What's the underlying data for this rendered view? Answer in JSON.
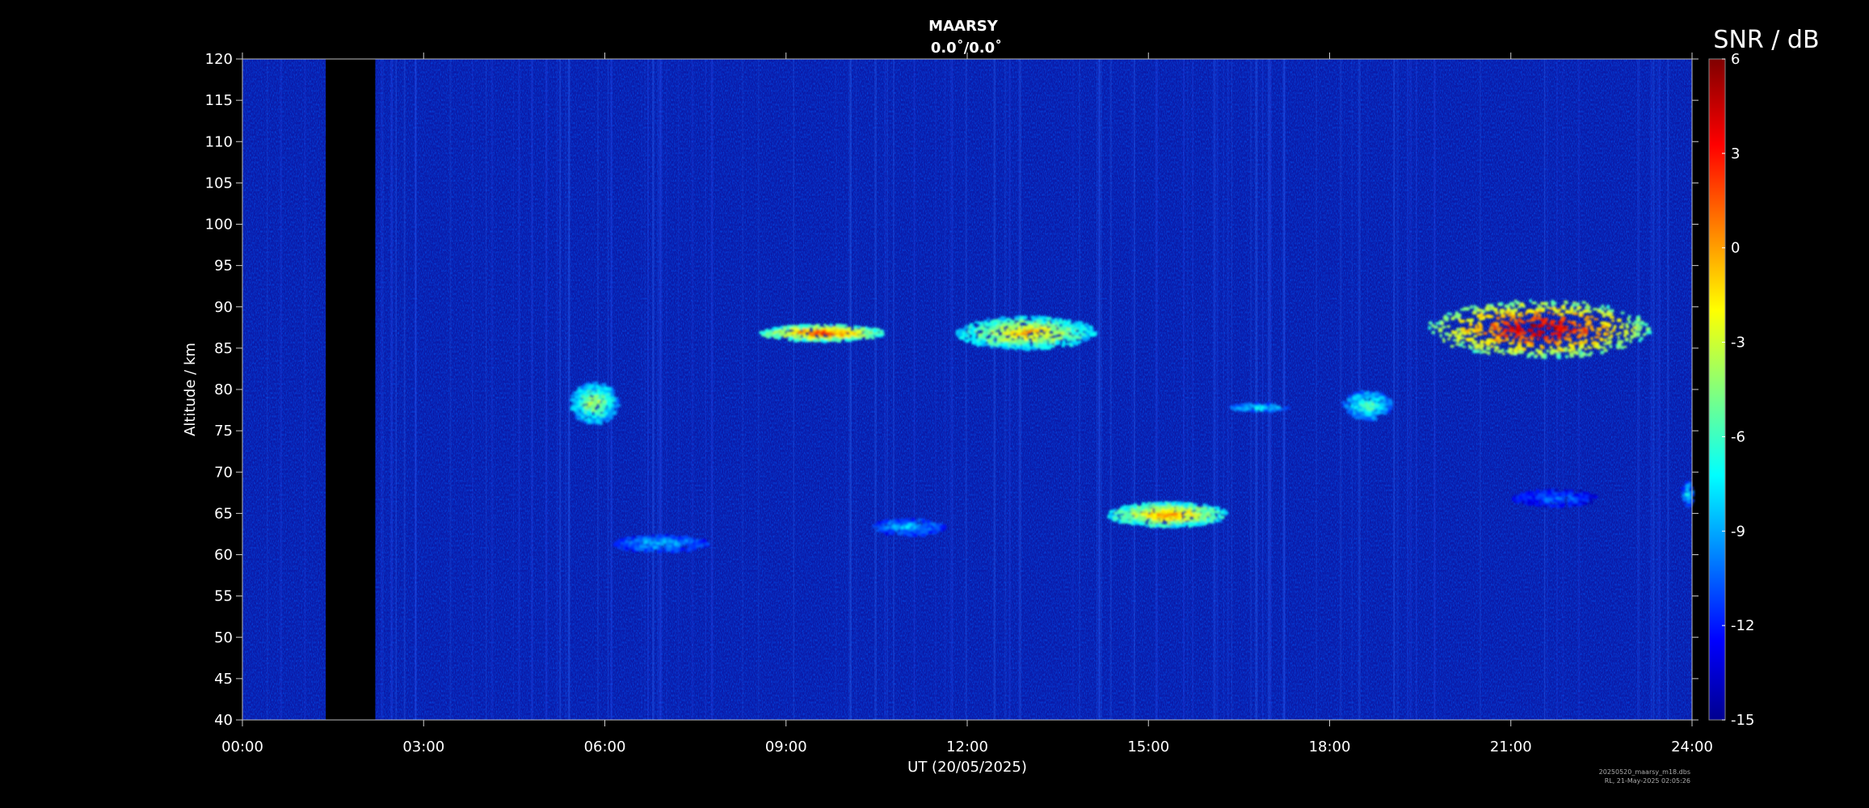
{
  "chart_data": {
    "type": "heatmap",
    "title": "MAARSY",
    "subtitle": "0.0˚/0.0˚",
    "xlabel": "UT (20/05/2025)",
    "ylabel": "Altitude / km",
    "x_ticks": [
      "00:00",
      "03:00",
      "06:00",
      "09:00",
      "12:00",
      "15:00",
      "18:00",
      "21:00",
      "24:00"
    ],
    "x_range_hours": [
      0,
      24
    ],
    "y_ticks": [
      40,
      45,
      50,
      55,
      60,
      65,
      70,
      75,
      80,
      85,
      90,
      95,
      100,
      105,
      110,
      115,
      120
    ],
    "ylim": [
      40,
      120
    ],
    "colorbar": {
      "title": "SNR / dB",
      "ticks": [
        6,
        3,
        0,
        -3,
        -6,
        -9,
        -12,
        -15
      ],
      "range": [
        -15,
        6
      ],
      "colormap": "jet"
    },
    "background_color": "#0a1aa8",
    "data_gap_hours": [
      1.38,
      2.2
    ],
    "echo_regions": [
      {
        "t_start": 8.55,
        "t_end": 10.6,
        "alt_min": 86,
        "alt_max": 88,
        "snr": 3
      },
      {
        "t_start": 11.8,
        "t_end": 14.1,
        "alt_min": 85,
        "alt_max": 89,
        "snr": 0
      },
      {
        "t_start": 19.6,
        "t_end": 23.3,
        "alt_min": 84,
        "alt_max": 91,
        "snr": 6
      },
      {
        "t_start": 14.3,
        "t_end": 16.3,
        "alt_min": 63.5,
        "alt_max": 66.5,
        "snr": 1
      },
      {
        "t_start": 5.4,
        "t_end": 6.2,
        "alt_min": 76,
        "alt_max": 81,
        "snr": -3
      },
      {
        "t_start": 6.1,
        "t_end": 7.7,
        "alt_min": 60.5,
        "alt_max": 62.5,
        "snr": -8
      },
      {
        "t_start": 10.4,
        "t_end": 11.6,
        "alt_min": 62.5,
        "alt_max": 64.5,
        "snr": -8
      },
      {
        "t_start": 16.3,
        "t_end": 17.3,
        "alt_min": 77.5,
        "alt_max": 78.5,
        "snr": -6
      },
      {
        "t_start": 18.2,
        "t_end": 19.0,
        "alt_min": 76.5,
        "alt_max": 80,
        "snr": -5
      },
      {
        "t_start": 21.0,
        "t_end": 22.4,
        "alt_min": 66,
        "alt_max": 68,
        "snr": -10
      },
      {
        "t_start": 23.8,
        "t_end": 24.0,
        "alt_min": 66,
        "alt_max": 69,
        "snr": -7
      }
    ]
  },
  "footer": {
    "line1": "20250520_maarsy_m18.dbs",
    "line2": "RL, 21-May-2025 02:05:26"
  }
}
